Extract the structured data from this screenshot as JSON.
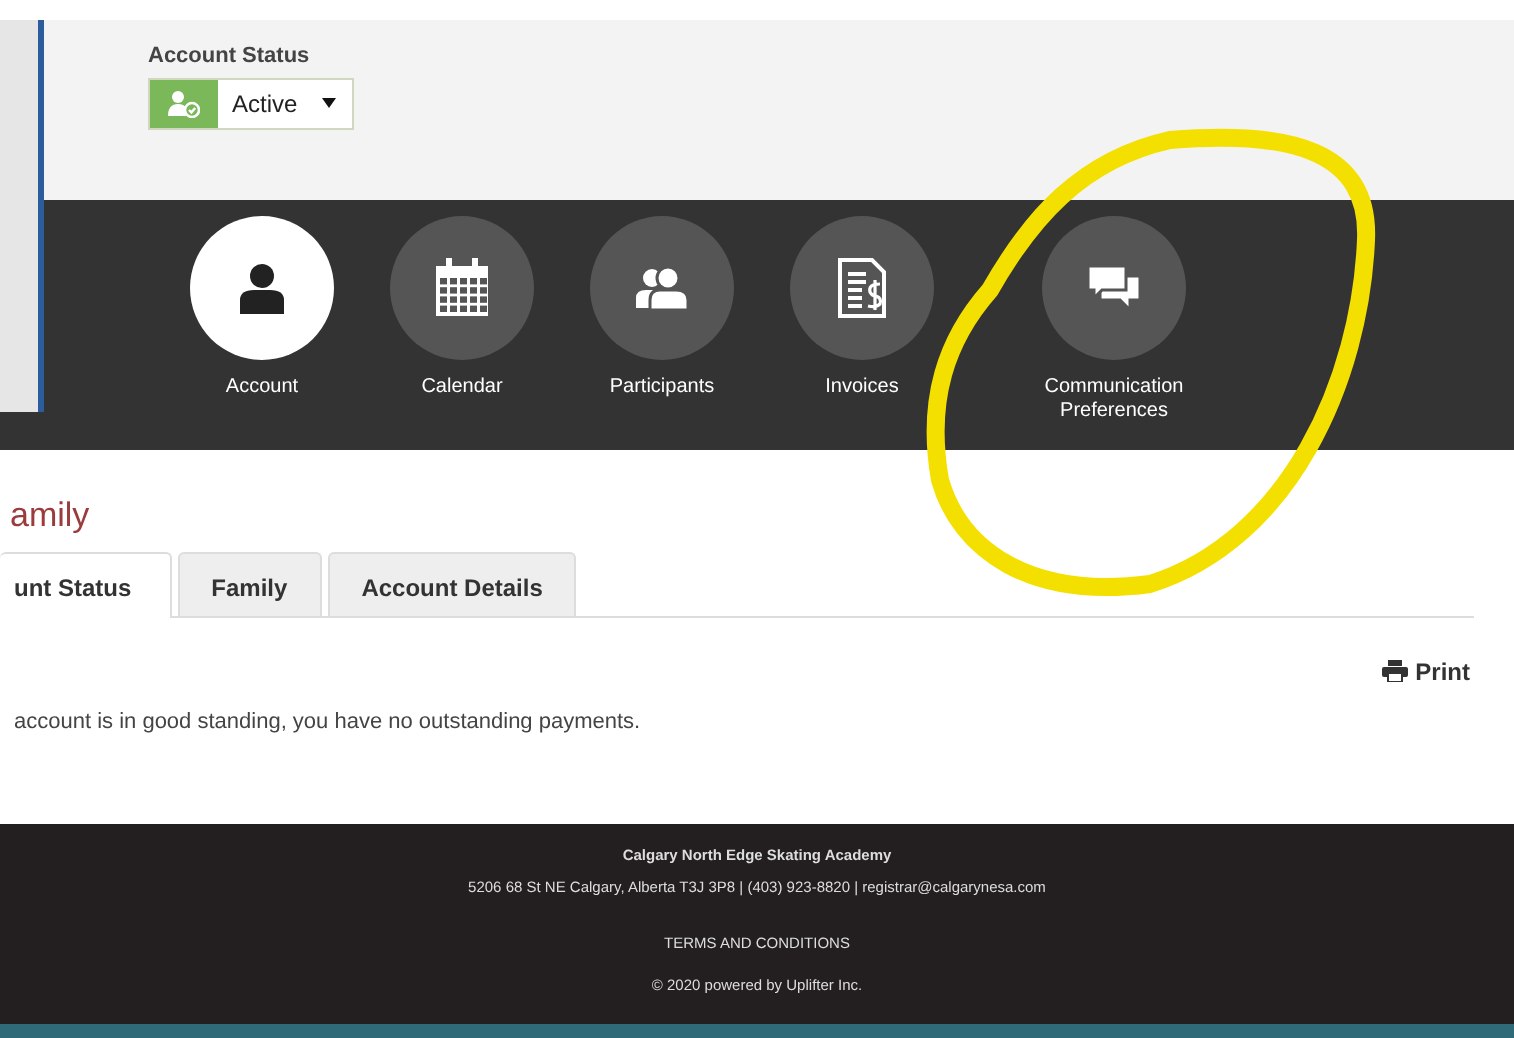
{
  "account_status": {
    "label": "Account Status",
    "value": "Active"
  },
  "nav": [
    {
      "label": "Account",
      "kind": "account",
      "selected": true
    },
    {
      "label": "Calendar",
      "kind": "calendar",
      "selected": false
    },
    {
      "label": "Participants",
      "kind": "participants",
      "selected": false
    },
    {
      "label": "Invoices",
      "kind": "invoices",
      "selected": false
    },
    {
      "label": "Communication Preferences",
      "kind": "communication",
      "selected": false
    }
  ],
  "section_title": "amily",
  "tabs": [
    {
      "label": "unt Status",
      "selected": true
    },
    {
      "label": "Family",
      "selected": false
    },
    {
      "label": "Account Details",
      "selected": false
    }
  ],
  "print": "Print",
  "message": "account is in good standing, you have no outstanding payments.",
  "footer": {
    "organization": "Calgary North Edge Skating Academy",
    "address": "5206 68 St NE Calgary, Alberta T3J 3P8 | (403) 923-8820 | registrar@calgarynesa.com",
    "terms": "TERMS AND CONDITIONS",
    "copyright": "© 2020 powered by Uplifter Inc."
  }
}
